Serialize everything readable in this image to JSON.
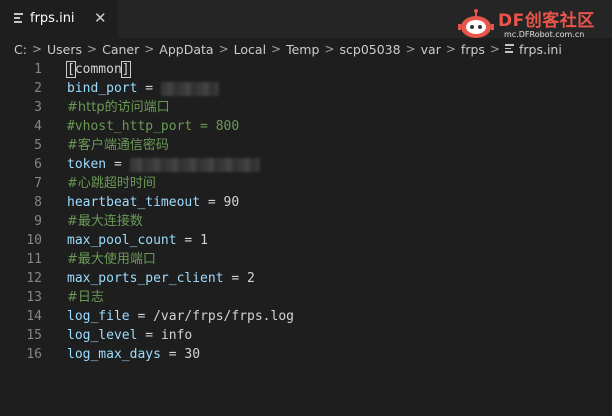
{
  "tab": {
    "label": "frps.ini",
    "close_glyph": "✕",
    "icon": "settings-file-icon"
  },
  "watermark": {
    "brand": "DF创客社区",
    "url": "mc.DFRobot.com.cn",
    "icon": "robot-icon"
  },
  "breadcrumb": {
    "segments": [
      "C:",
      "Users",
      "Caner",
      "AppData",
      "Local",
      "Temp",
      "scp05038",
      "var",
      "frps"
    ],
    "file": "frps.ini",
    "separator": ">"
  },
  "editor": {
    "colors": {
      "key": "#9cdcfe",
      "comment": "#6a9955",
      "text": "#d4d4d4",
      "line_number": "#858585",
      "background": "#1e1e1e"
    },
    "lines": [
      {
        "num": "1",
        "section_open": "[",
        "section_name": "common",
        "section_close": "]"
      },
      {
        "num": "2",
        "key": "bind_port",
        "eq": " = ",
        "redacted": true
      },
      {
        "num": "3",
        "comment": "#http的访问端口"
      },
      {
        "num": "4",
        "comment": "#vhost_http_port = 800"
      },
      {
        "num": "5",
        "comment": "#客户端通信密码"
      },
      {
        "num": "6",
        "key": "token",
        "eq": " = ",
        "redacted": true
      },
      {
        "num": "7",
        "comment": "#心跳超时时间"
      },
      {
        "num": "8",
        "key": "heartbeat_timeout",
        "eq": " = ",
        "value": "90"
      },
      {
        "num": "9",
        "comment": "#最大连接数"
      },
      {
        "num": "10",
        "key": "max_pool_count",
        "eq": " = ",
        "value": "1"
      },
      {
        "num": "11",
        "comment": "#最大使用端口"
      },
      {
        "num": "12",
        "key": "max_ports_per_client",
        "eq": " = ",
        "value": "2"
      },
      {
        "num": "13",
        "comment": "#日志"
      },
      {
        "num": "14",
        "key": "log_file",
        "eq": " = ",
        "value": "/var/frps/frps.log"
      },
      {
        "num": "15",
        "key": "log_level",
        "eq": " = ",
        "value": "info"
      },
      {
        "num": "16",
        "key": "log_max_days",
        "eq": " = ",
        "value": "30"
      }
    ]
  }
}
